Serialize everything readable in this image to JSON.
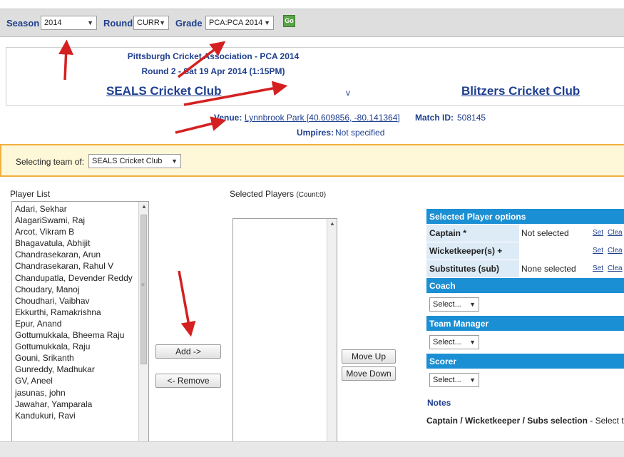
{
  "filters": {
    "season_label": "Season",
    "season_value": "2014",
    "round_label": "Round",
    "round_value": "CURR",
    "grade_label": "Grade",
    "grade_value": "PCA:PCA 2014",
    "go_label": "Go"
  },
  "match": {
    "association": "Pittsburgh Cricket Association - PCA 2014",
    "round": "Round 2 - Sat 19 Apr 2014 (1:15PM)",
    "home_team": "SEALS Cricket Club",
    "vs": "v",
    "away_team": "Blitzers Cricket Club",
    "venue_label": "Venue:",
    "venue_value": "Lynnbrook Park [40.609856, -80.141364]",
    "match_id_label": "Match ID:",
    "match_id_value": "508145",
    "umpires_label": "Umpires:",
    "umpires_value": "Not specified"
  },
  "team_select": {
    "label": "Selecting team of:",
    "value": "SEALS Cricket Club"
  },
  "player_list": {
    "title": "Player List",
    "players": [
      "Adari, Sekhar",
      "AlagariSwami, Raj",
      "Arcot, Vikram B",
      "Bhagavatula, Abhijit",
      "Chandrasekaran, Arun",
      "Chandrasekaran, Rahul V",
      "Chandupatla, Devender Reddy",
      "Choudary, Manoj",
      "Choudhari, Vaibhav",
      "Ekkurthi, Ramakrishna",
      "Epur, Anand",
      "Gottumukkala, Bheema Raju",
      "Gottumukkala, Raju",
      "Gouni, Srikanth",
      "Gunreddy, Madhukar",
      "GV, Aneel",
      "jasunas, john",
      "Jawahar, Yamparala",
      "Kandukuri, Ravi"
    ]
  },
  "selected_players": {
    "title": "Selected Players",
    "count": "(Count:0)"
  },
  "buttons": {
    "add": "Add ->",
    "remove": "<- Remove",
    "move_up": "Move Up",
    "move_down": "Move Down"
  },
  "options": {
    "header": "Selected Player options",
    "rows": [
      {
        "label": "Captain *",
        "value": "Not selected",
        "set": "Set",
        "clear": "Clea"
      },
      {
        "label": "Wicketkeeper(s) +",
        "value": "",
        "set": "Set",
        "clear": "Clea"
      },
      {
        "label": "Substitutes (sub)",
        "value": "None selected",
        "set": "Set",
        "clear": "Clea"
      }
    ],
    "coach_label": "Coach",
    "coach_value": "Select...",
    "manager_label": "Team Manager",
    "manager_value": "Select...",
    "scorer_label": "Scorer",
    "scorer_value": "Select...",
    "notes_label": "Notes",
    "notes_bold": "Captain / Wicketkeeper / Subs selection",
    "notes_text": " - Select the"
  },
  "colors": {
    "header_blue": "#1b8fd4",
    "link_blue": "#1f3f8f",
    "arrow_red": "#d42020",
    "banner_bg": "#fff8d8",
    "banner_border": "#f0b040"
  }
}
